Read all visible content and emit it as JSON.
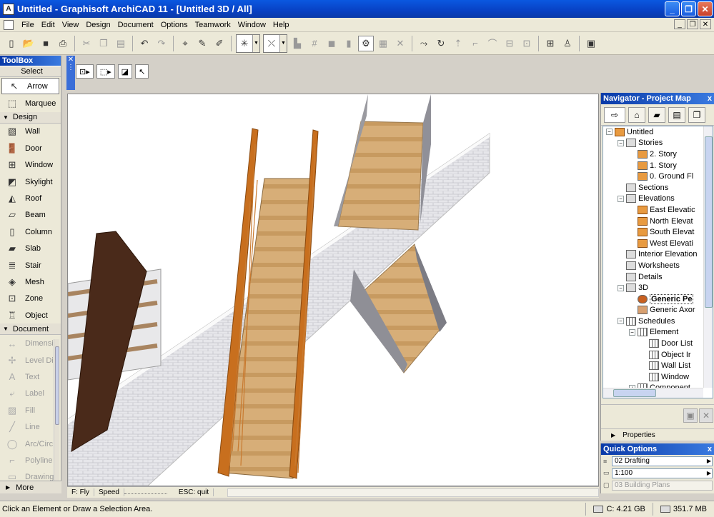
{
  "window": {
    "title": "Untitled - Graphisoft ArchiCAD 11 - [Untitled 3D / All]",
    "controls": {
      "minimize": "_",
      "restore": "❐",
      "close": "✕"
    }
  },
  "menu": {
    "items": [
      "File",
      "Edit",
      "View",
      "Design",
      "Document",
      "Options",
      "Teamwork",
      "Window",
      "Help"
    ]
  },
  "toolbox": {
    "title": "ToolBox",
    "select_header": "Select",
    "select_items": [
      {
        "label": "Arrow",
        "icon": "arrow-icon"
      },
      {
        "label": "Marquee",
        "icon": "marquee-icon"
      }
    ],
    "design_header": "Design",
    "design_items": [
      {
        "label": "Wall",
        "icon": "wall-icon"
      },
      {
        "label": "Door",
        "icon": "door-icon"
      },
      {
        "label": "Window",
        "icon": "window-icon"
      },
      {
        "label": "Skylight",
        "icon": "skylight-icon"
      },
      {
        "label": "Roof",
        "icon": "roof-icon"
      },
      {
        "label": "Beam",
        "icon": "beam-icon"
      },
      {
        "label": "Column",
        "icon": "column-icon"
      },
      {
        "label": "Slab",
        "icon": "slab-icon"
      },
      {
        "label": "Stair",
        "icon": "stair-icon"
      },
      {
        "label": "Mesh",
        "icon": "mesh-icon"
      },
      {
        "label": "Zone",
        "icon": "zone-icon"
      },
      {
        "label": "Object",
        "icon": "object-icon"
      }
    ],
    "document_header": "Document",
    "document_items": [
      {
        "label": "Dimensi",
        "icon": "dimension-icon"
      },
      {
        "label": "Level Di",
        "icon": "level-dimension-icon"
      },
      {
        "label": "Text",
        "icon": "text-icon"
      },
      {
        "label": "Label",
        "icon": "label-icon"
      },
      {
        "label": "Fill",
        "icon": "fill-icon"
      },
      {
        "label": "Line",
        "icon": "line-icon"
      },
      {
        "label": "Arc/Circ",
        "icon": "arc-icon"
      },
      {
        "label": "Polyline",
        "icon": "polyline-icon"
      },
      {
        "label": "Drawing",
        "icon": "drawing-icon"
      }
    ],
    "more_label": "More"
  },
  "view_status": {
    "mode": "F: Fly",
    "speed": "Speed",
    "quit": "ESC: quit"
  },
  "navigator": {
    "title": "Navigator - Project Map",
    "close": "x",
    "tree": [
      {
        "label": "Untitled",
        "indent": 0,
        "exp": "−",
        "icon": "house"
      },
      {
        "label": "Stories",
        "indent": 1,
        "exp": "−",
        "icon": "sheet"
      },
      {
        "label": "2. Story",
        "indent": 2,
        "exp": "",
        "icon": "story"
      },
      {
        "label": "1. Story",
        "indent": 2,
        "exp": "",
        "icon": "story"
      },
      {
        "label": "0. Ground Fl",
        "indent": 2,
        "exp": "",
        "icon": "story"
      },
      {
        "label": "Sections",
        "indent": 1,
        "exp": "",
        "icon": "sheet"
      },
      {
        "label": "Elevations",
        "indent": 1,
        "exp": "−",
        "icon": "sheet"
      },
      {
        "label": "East Elevatic",
        "indent": 2,
        "exp": "",
        "icon": "house"
      },
      {
        "label": "North Elevat",
        "indent": 2,
        "exp": "",
        "icon": "house"
      },
      {
        "label": "South Elevat",
        "indent": 2,
        "exp": "",
        "icon": "house"
      },
      {
        "label": "West Elevati",
        "indent": 2,
        "exp": "",
        "icon": "house"
      },
      {
        "label": "Interior Elevation",
        "indent": 1,
        "exp": "",
        "icon": "sheet"
      },
      {
        "label": "Worksheets",
        "indent": 1,
        "exp": "",
        "icon": "sheet"
      },
      {
        "label": "Details",
        "indent": 1,
        "exp": "",
        "icon": "sheet"
      },
      {
        "label": "3D",
        "indent": 1,
        "exp": "−",
        "icon": "sheet"
      },
      {
        "label": "Generic Pe",
        "indent": 2,
        "exp": "",
        "icon": "cam",
        "bold": true
      },
      {
        "label": "Generic Axor",
        "indent": 2,
        "exp": "",
        "icon": "box"
      },
      {
        "label": "Schedules",
        "indent": 1,
        "exp": "−",
        "icon": "grid"
      },
      {
        "label": "Element",
        "indent": 2,
        "exp": "−",
        "icon": "grid"
      },
      {
        "label": "Door List",
        "indent": 3,
        "exp": "",
        "icon": "grid"
      },
      {
        "label": "Object Ir",
        "indent": 3,
        "exp": "",
        "icon": "grid"
      },
      {
        "label": "Wall List",
        "indent": 3,
        "exp": "",
        "icon": "grid"
      },
      {
        "label": "Window",
        "indent": 3,
        "exp": "",
        "icon": "grid"
      },
      {
        "label": "Component",
        "indent": 2,
        "exp": "+",
        "icon": "grid"
      }
    ],
    "properties_label": "Properties"
  },
  "quick_options": {
    "title": "Quick Options",
    "close": "x",
    "layer_combo": "02 Drafting",
    "scale": "1:100",
    "layout": "03 Building Plans"
  },
  "status": {
    "message": "Click an Element or Draw a Selection Area.",
    "disk": "C: 4.21 GB",
    "memory": "351.7 MB"
  }
}
